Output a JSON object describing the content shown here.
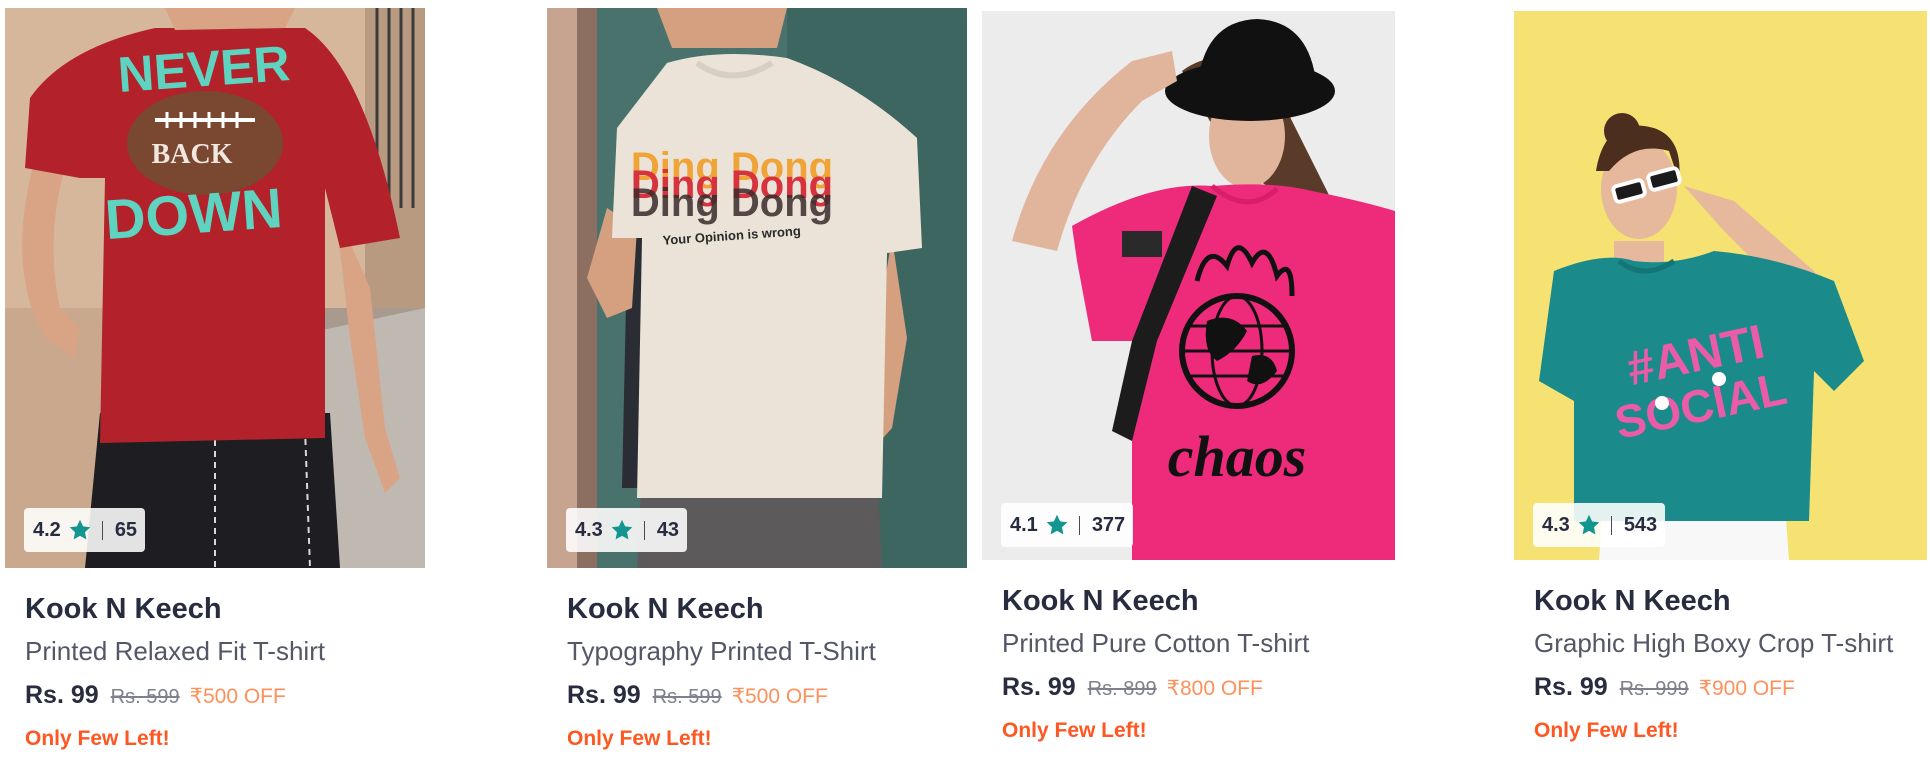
{
  "products": [
    {
      "rating": "4.2",
      "count": "65",
      "brand": "Kook N Keech",
      "name": "Printed Relaxed Fit T-shirt",
      "price": "Rs. 99",
      "mrp": "Rs. 599",
      "discount": "₹500 OFF",
      "stock": "Only Few Left!",
      "tee_print": [
        "NEVER",
        "BACK",
        "DOWN"
      ]
    },
    {
      "rating": "4.3",
      "count": "43",
      "brand": "Kook N Keech",
      "name": "Typography Printed T-Shirt",
      "price": "Rs. 99",
      "mrp": "Rs. 599",
      "discount": "₹500 OFF",
      "stock": "Only Few Left!",
      "tee_print": [
        "Ding Dong",
        "Ding Dong",
        "Your Opinion is wrong"
      ]
    },
    {
      "rating": "4.1",
      "count": "377",
      "brand": "Kook N Keech",
      "name": "Printed Pure Cotton T-shirt",
      "price": "Rs. 99",
      "mrp": "Rs. 899",
      "discount": "₹800 OFF",
      "stock": "Only Few Left!",
      "tee_print": [
        "chaos"
      ]
    },
    {
      "rating": "4.3",
      "count": "543",
      "brand": "Kook N Keech",
      "name": "Graphic High Boxy Crop T-shirt",
      "price": "Rs. 99",
      "mrp": "Rs. 999",
      "discount": "₹900 OFF",
      "stock": "Only Few Left!",
      "tee_print": [
        "#ANTI",
        "SOCIAL"
      ]
    }
  ],
  "colors": {
    "rating_star": "#14958f",
    "discount": "#ff905a",
    "stock_alert": "#ff5722",
    "brand_text": "#282c3f"
  },
  "icons": {
    "rating": "star-icon"
  }
}
